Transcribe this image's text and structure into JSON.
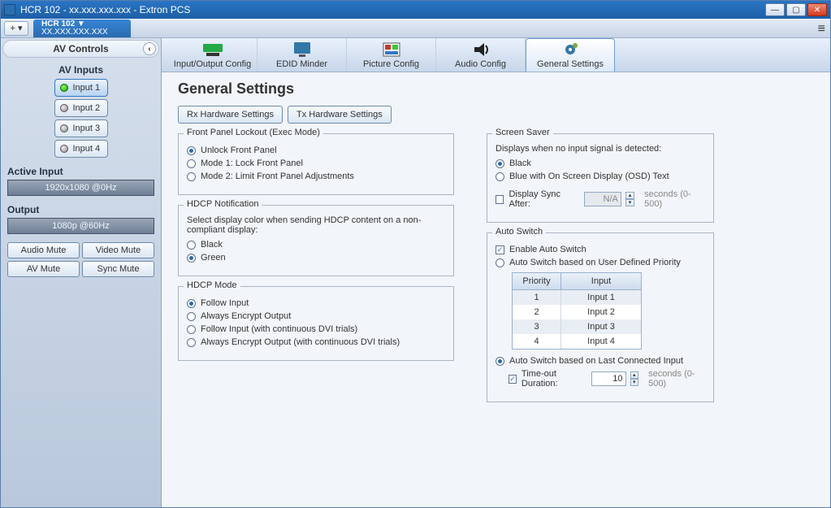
{
  "window": {
    "title": "HCR 102 - xx.xxx.xxx.xxx - Extron PCS"
  },
  "doctab": {
    "name": "HCR 102 ▼",
    "addr": "XX.XXX.XXX.XXX"
  },
  "sidebar": {
    "title": "AV Controls",
    "inputs_label": "AV Inputs",
    "inputs": [
      {
        "label": "Input 1",
        "active": true
      },
      {
        "label": "Input 2",
        "active": false
      },
      {
        "label": "Input 3",
        "active": false
      },
      {
        "label": "Input 4",
        "active": false
      }
    ],
    "active_input_label": "Active Input",
    "active_input_value": "1920x1080 @0Hz",
    "output_label": "Output",
    "output_value": "1080p @60Hz",
    "mutes": {
      "audio": "Audio Mute",
      "video": "Video Mute",
      "av": "AV Mute",
      "sync": "Sync Mute"
    }
  },
  "tabs": {
    "io": "Input/Output Config",
    "edid": "EDID Minder",
    "picture": "Picture Config",
    "audio": "Audio Config",
    "general": "General Settings"
  },
  "page": {
    "title": "General Settings"
  },
  "hw": {
    "rx": "Rx Hardware Settings",
    "tx": "Tx Hardware Settings"
  },
  "fpl": {
    "legend": "Front Panel Lockout (Exec Mode)",
    "unlock": "Unlock Front Panel",
    "mode1": "Mode 1: Lock Front Panel",
    "mode2": "Mode 2: Limit Front Panel Adjustments"
  },
  "hdcpn": {
    "legend": "HDCP Notification",
    "note": "Select display color when sending HDCP content on a non-compliant display:",
    "black": "Black",
    "green": "Green"
  },
  "hdcpm": {
    "legend": "HDCP Mode",
    "follow": "Follow Input",
    "always": "Always Encrypt Output",
    "followdvi": "Follow Input (with continuous DVI trials)",
    "alwaysdvi": "Always Encrypt Output (with continuous DVI trials)"
  },
  "ss": {
    "legend": "Screen Saver",
    "note": "Displays when no input signal is detected:",
    "black": "Black",
    "blue": "Blue with On Screen Display (OSD) Text",
    "dsync": "Display Sync After:",
    "dsync_val": "N/A",
    "dsync_hint": "seconds (0-500)"
  },
  "as": {
    "legend": "Auto Switch",
    "enable": "Enable Auto Switch",
    "userpri": "Auto Switch based on User Defined Priority",
    "th_pri": "Priority",
    "th_inp": "Input",
    "rows": [
      {
        "p": "1",
        "i": "Input 1"
      },
      {
        "p": "2",
        "i": "Input 2"
      },
      {
        "p": "3",
        "i": "Input 3"
      },
      {
        "p": "4",
        "i": "Input 4"
      }
    ],
    "lastconn": "Auto Switch based on Last Connected Input",
    "timeout": "Time-out Duration:",
    "timeout_val": "10",
    "timeout_hint": "seconds (0-500)"
  }
}
